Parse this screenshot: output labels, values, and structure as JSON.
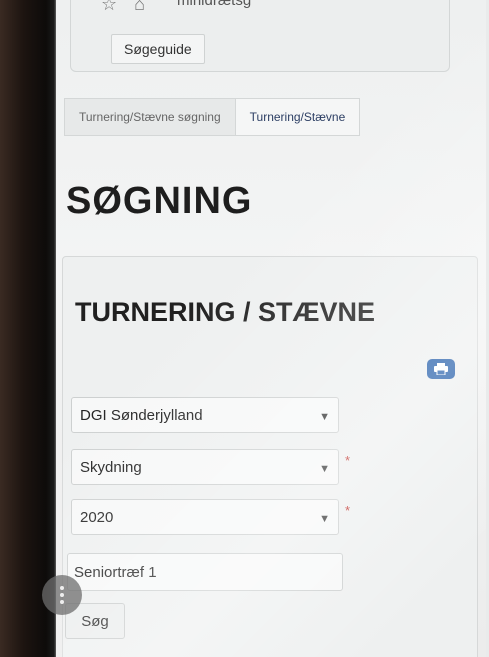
{
  "browser": {
    "title": "minidrætsg"
  },
  "header": {
    "guide_button": "Søgeguide"
  },
  "tabs": [
    {
      "label": "Turnering/Stævne søgning",
      "active": false
    },
    {
      "label": "Turnering/Stævne",
      "active": true
    }
  ],
  "page_title": "SØGNING",
  "panel": {
    "title": "TURNERING / STÆVNE",
    "print_icon": "printer-icon",
    "fields": {
      "region": {
        "value": "DGI Sønderjylland",
        "required": false
      },
      "sport": {
        "value": "Skydning",
        "required": true
      },
      "year": {
        "value": "2020",
        "required": true
      },
      "name": {
        "value": "Seniortræf 1"
      }
    },
    "required_mark": "*",
    "search_button": "Søg"
  },
  "colors": {
    "accent": "#1b57a6",
    "required": "#c0302a",
    "active_tab_text": "#2c3e63"
  }
}
